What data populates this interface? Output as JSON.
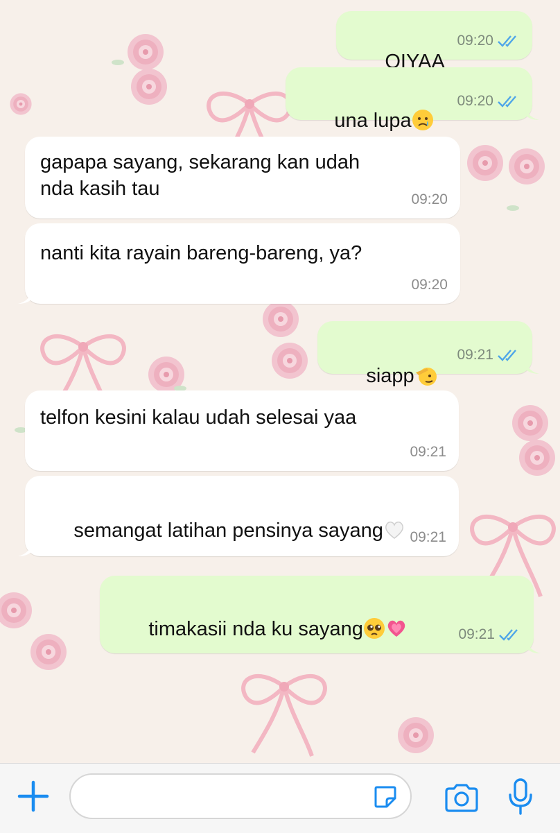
{
  "colors": {
    "outgoing_bubble": "#e3fbcf",
    "incoming_bubble": "#ffffff",
    "read_ticks": "#4fa6e8",
    "accent": "#1a8cf0"
  },
  "messages": [
    {
      "direction": "outgoing",
      "text": "OIYAA",
      "time": "09:20",
      "status": "read"
    },
    {
      "direction": "outgoing",
      "text": "una lupa",
      "emoji": [
        "crying-face-emoji"
      ],
      "time": "09:20",
      "status": "read"
    },
    {
      "direction": "incoming",
      "text": "gapapa sayang, sekarang kan udah\nnda kasih tau",
      "time": "09:20"
    },
    {
      "direction": "incoming",
      "text": "nanti kita rayain bareng-bareng, ya?",
      "time": "09:20"
    },
    {
      "direction": "outgoing",
      "text": "siapp",
      "emoji": [
        "saluting-face-emoji"
      ],
      "time": "09:21",
      "status": "read"
    },
    {
      "direction": "incoming",
      "text": "telfon kesini kalau udah selesai yaa",
      "time": "09:21"
    },
    {
      "direction": "incoming",
      "text": "semangat latihan pensinya sayang",
      "emoji": [
        "white-heart-emoji"
      ],
      "time": "09:21"
    },
    {
      "direction": "outgoing",
      "text": "timakasii nda ku sayang",
      "emoji": [
        "pleading-face-emoji",
        "growing-heart-emoji"
      ],
      "time": "09:21",
      "status": "read"
    }
  ],
  "input_bar": {
    "icons": [
      "plus-icon",
      "sticker-icon",
      "camera-icon",
      "microphone-icon"
    ],
    "message_placeholder": ""
  }
}
